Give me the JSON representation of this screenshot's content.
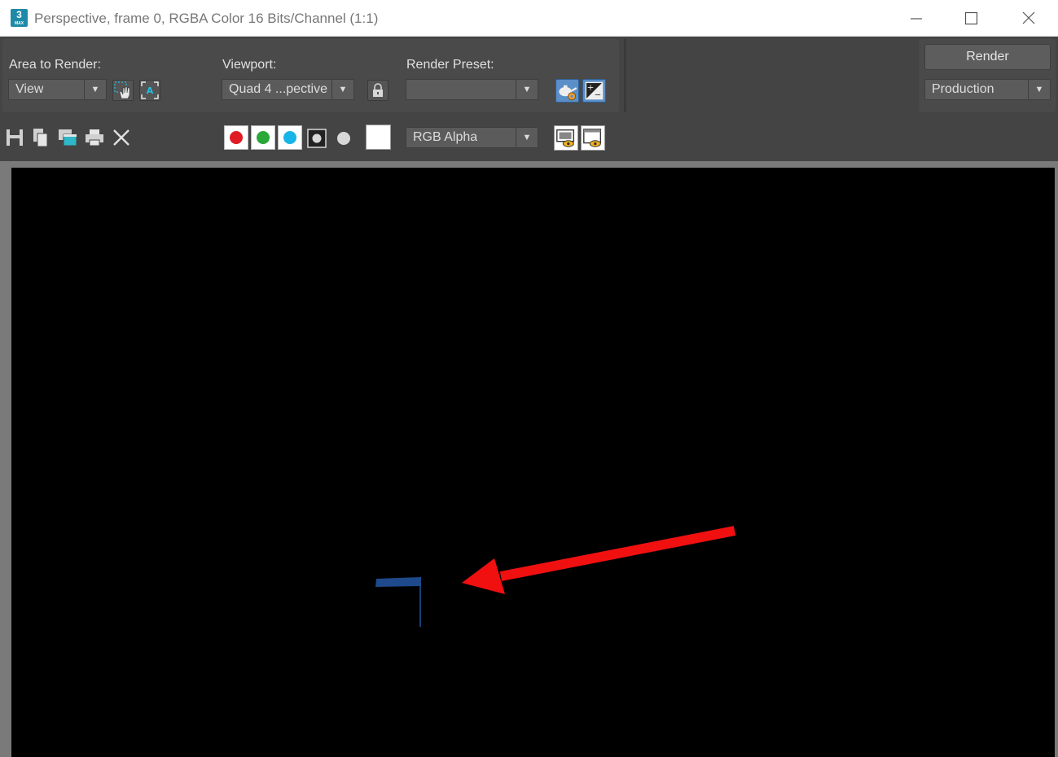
{
  "window": {
    "title": "Perspective, frame 0, RGBA Color 16 Bits/Channel (1:1)",
    "app_icon_text": "3",
    "app_icon_subtext": "MAX"
  },
  "controls": {
    "area_label": "Area to Render:",
    "area_value": "View",
    "viewport_label": "Viewport:",
    "viewport_value": "Quad 4 ...pective",
    "preset_label": "Render Preset:",
    "preset_value": "",
    "render_button": "Render",
    "render_type_value": "Production"
  },
  "toolbar": {
    "channel_display": "RGB Alpha"
  },
  "colors": {
    "red_channel": "#e01b24",
    "green_channel": "#2aa838",
    "blue_channel": "#16b4e8",
    "annotation_arrow": "#f01010",
    "rendered_object": "#1e4a8c"
  }
}
